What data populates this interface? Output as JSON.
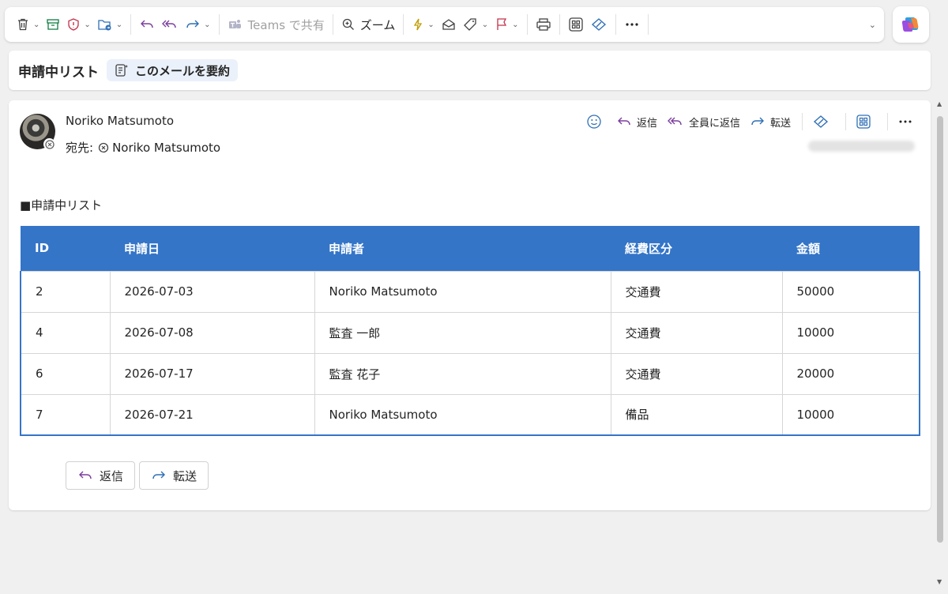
{
  "toolbar": {
    "teams_share": "Teams で共有",
    "zoom": "ズーム"
  },
  "subject": {
    "title": "申請中リスト",
    "summarize": "このメールを要約"
  },
  "message": {
    "sender": "Noriko Matsumoto",
    "to_label": "宛先:",
    "to_name": "Noriko Matsumoto",
    "actions": {
      "reply": "返信",
      "reply_all": "全員に返信",
      "forward": "転送"
    },
    "body_heading": "■申請中リスト",
    "table": {
      "headers": [
        "ID",
        "申請日",
        "申請者",
        "経費区分",
        "金額"
      ],
      "rows": [
        [
          "2",
          "2026-07-03",
          "Noriko Matsumoto",
          "交通費",
          "50000"
        ],
        [
          "4",
          "2026-07-08",
          "監査 一郎",
          "交通費",
          "10000"
        ],
        [
          "6",
          "2026-07-17",
          "監査 花子",
          "交通費",
          "20000"
        ],
        [
          "7",
          "2026-07-21",
          "Noriko Matsumoto",
          "備品",
          "10000"
        ]
      ]
    },
    "bottom_buttons": {
      "reply": "返信",
      "forward": "転送"
    }
  },
  "colors": {
    "table_header": "#3475c8",
    "accent_purple": "#7a3f9d",
    "accent_blue": "#2f6fb6"
  }
}
